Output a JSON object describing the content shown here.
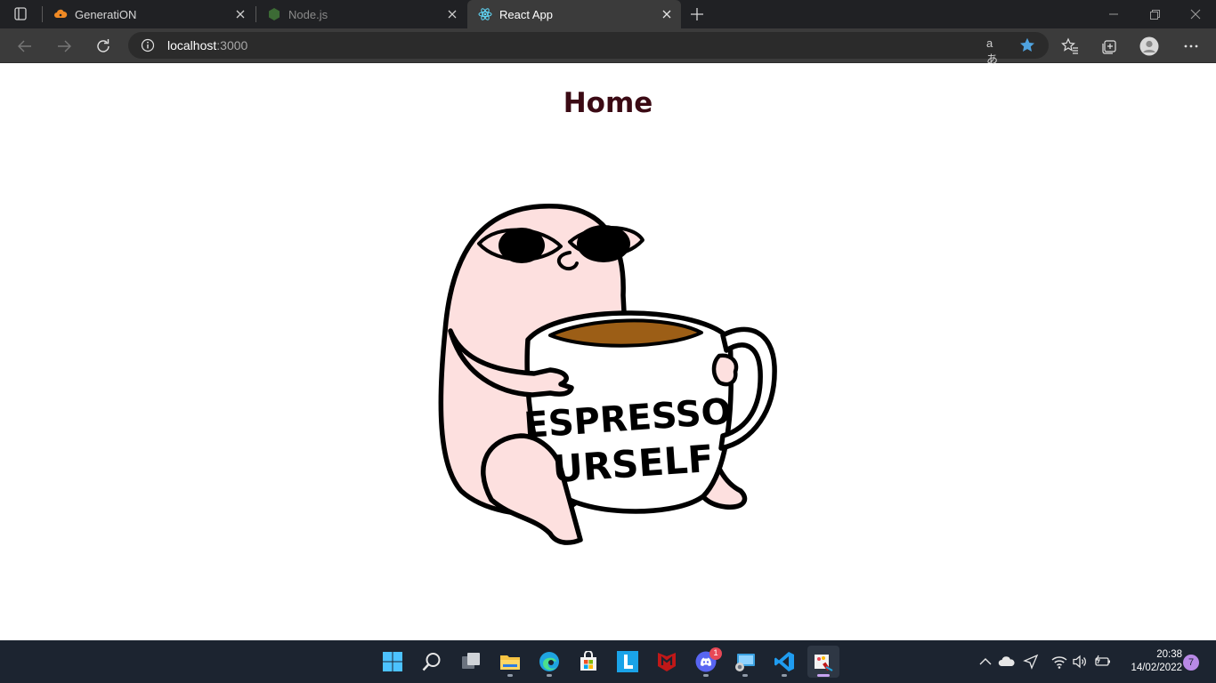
{
  "browser": {
    "tabs": [
      {
        "title": "GeneratiON",
        "active": false
      },
      {
        "title": "Node.js",
        "active": false
      },
      {
        "title": "React App",
        "active": true
      }
    ],
    "address": {
      "host": "localhost",
      "port": ":3000"
    },
    "read_aloud_glyph": "aあ"
  },
  "page": {
    "heading": "Home",
    "sticker": {
      "mug_line1": "ESPRESSO",
      "mug_line2": "URSELF"
    },
    "colors": {
      "heading": "#3b0a14",
      "creature": "#fde0df",
      "coffee": "#9c5e16"
    }
  },
  "taskbar": {
    "apps": [
      "start-icon",
      "search-icon",
      "task-view-icon",
      "file-explorer-icon",
      "edge-icon",
      "store-icon",
      "l-app-icon",
      "mcafee-icon",
      "discord-icon",
      "remote-desktop-icon",
      "vscode-icon",
      "paint-icon"
    ],
    "discord_badge": "1",
    "clock_time": "20:38",
    "clock_date": "14/02/2022",
    "notification_count": "7"
  }
}
